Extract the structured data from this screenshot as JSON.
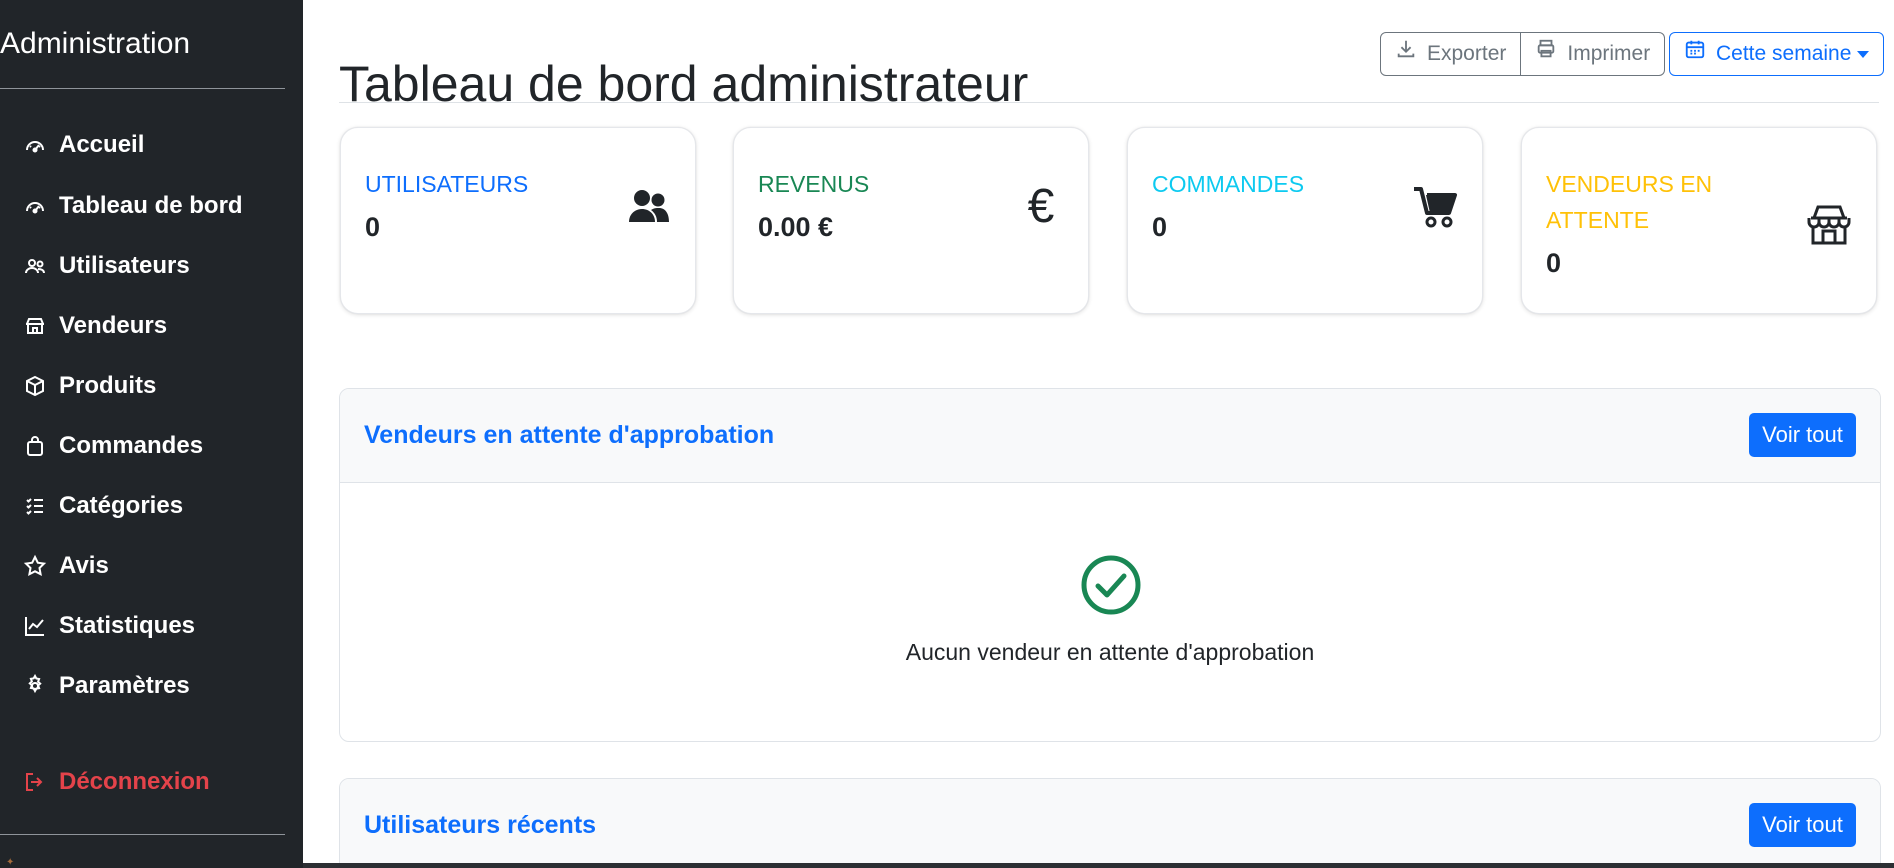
{
  "sidebar": {
    "brand": "Administration",
    "items": [
      {
        "label": "Accueil",
        "icon": "speedometer-icon"
      },
      {
        "label": "Tableau de bord",
        "icon": "speedometer-icon"
      },
      {
        "label": "Utilisateurs",
        "icon": "people-icon"
      },
      {
        "label": "Vendeurs",
        "icon": "shop-icon"
      },
      {
        "label": "Produits",
        "icon": "box-icon"
      },
      {
        "label": "Commandes",
        "icon": "bag-icon"
      },
      {
        "label": "Catégories",
        "icon": "list-check-icon"
      },
      {
        "label": "Avis",
        "icon": "star-icon"
      },
      {
        "label": "Statistiques",
        "icon": "graph-up-icon"
      },
      {
        "label": "Paramètres",
        "icon": "gear-icon"
      }
    ],
    "logout": {
      "label": "Déconnexion",
      "icon": "box-arrow-right-icon"
    }
  },
  "header": {
    "title": "Tableau de bord administrateur",
    "export_label": "Exporter",
    "print_label": "Imprimer",
    "period_label": "Cette semaine"
  },
  "stats": [
    {
      "label": "UTILISATEURS",
      "value": "0",
      "color": "#0d6efd",
      "icon": "people-icon"
    },
    {
      "label": "REVENUS",
      "value": "0.00 €",
      "color": "#198754",
      "icon": "euro-icon",
      "glyph": "€"
    },
    {
      "label": "COMMANDES",
      "value": "0",
      "color": "#0dcaf0",
      "icon": "cart-icon"
    },
    {
      "label": "VENDEURS EN ATTENTE",
      "value": "0",
      "color": "#ffc107",
      "icon": "shop-icon"
    }
  ],
  "pending_sellers": {
    "title": "Vendeurs en attente d'approbation",
    "button": "Voir tout",
    "empty_message": "Aucun vendeur en attente d'approbation"
  },
  "recent_users": {
    "title": "Utilisateurs récents",
    "button": "Voir tout"
  },
  "colors": {
    "sidebar_bg": "#212529",
    "primary": "#0d6efd",
    "danger": "#dc3545",
    "success": "#198754"
  }
}
